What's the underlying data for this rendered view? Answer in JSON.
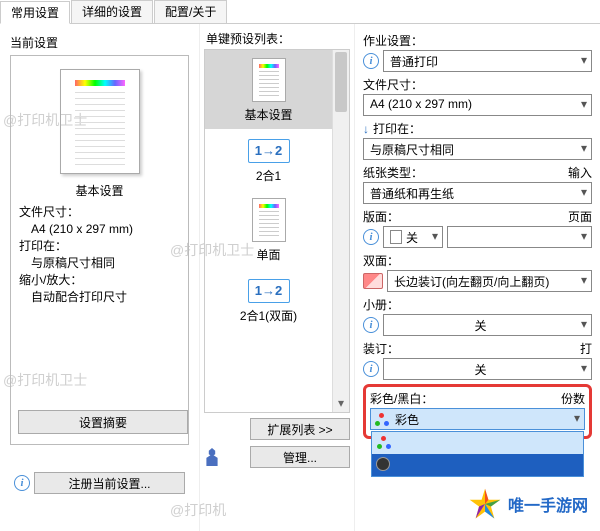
{
  "tabs": {
    "common": "常用设置",
    "detail": "详细的设置",
    "config": "配置/关于"
  },
  "left": {
    "group": "当前设置",
    "preview_caption": "基本设置",
    "lines": {
      "l1": "文件尺寸：",
      "l1v": "A4 (210 x 297 mm)",
      "l2": "打印在：",
      "l2v": "与原稿尺寸相同",
      "l3": "缩小/放大：",
      "l3v": "自动配合打印尺寸"
    },
    "summary_btn": "设置摘要",
    "register_btn": "注册当前设置..."
  },
  "middle": {
    "label": "单键预设列表：",
    "items": {
      "basic": "基本设置",
      "two_in_one": "2合1",
      "glyph12": "1→2",
      "simplex": "单面",
      "two_in_one_dup": "2合1(双面)"
    },
    "expand_btn": "扩展列表 >>",
    "manage_btn": "管理..."
  },
  "right": {
    "job_label": "作业设置：",
    "job_value": "普通打印",
    "doc_label": "文件尺寸：",
    "doc_value": "A4 (210 x 297 mm)",
    "printon_label": "打印在：",
    "printon_value": "与原稿尺寸相同",
    "paper_label": "纸张类型：",
    "paper_value": "普通纸和再生纸",
    "input_label": "输入",
    "layout_label": "版面：",
    "layout_value": "关",
    "page_label": "页面",
    "duplex_label": "双面：",
    "duplex_value": "长边装订(向左翻页/向上翻页)",
    "booklet_label": "小册：",
    "booklet_value": "关",
    "bind_label": "装订：",
    "bind_value": "关",
    "bind_side_label": "打",
    "color_label": "彩色/黑白：",
    "color_value": "彩色",
    "copies_label": "份数"
  },
  "watermarks": {
    "w1": "@打印机卫士",
    "w2": "@打印机卫士",
    "w3": "@打印机卫士",
    "w4": "@打印机"
  },
  "brand": "唯一手游网"
}
